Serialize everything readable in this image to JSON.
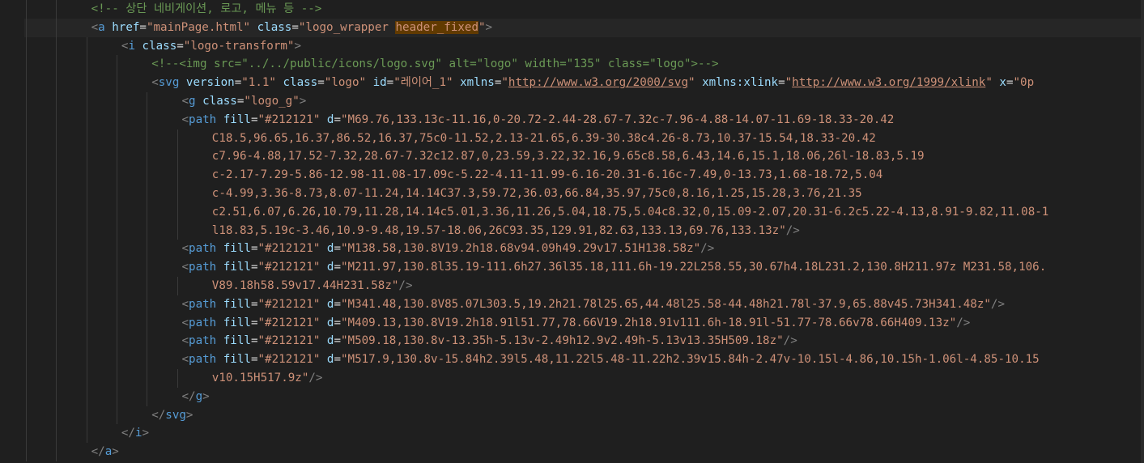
{
  "colors": {
    "background": "#1f1f1f",
    "comment": "#6a9955",
    "tag": "#569cd6",
    "attribute": "#9cdcfe",
    "string": "#ce9178",
    "punctuation": "#808080",
    "highlight": "#613a00"
  },
  "lines": [
    {
      "indent": 2,
      "tokens": [
        {
          "t": "com",
          "v": "<!-- 상단 네비게이션, 로고, 메뉴 등 -->"
        }
      ]
    },
    {
      "indent": 2,
      "active": true,
      "tokens": [
        {
          "t": "punc",
          "v": "<"
        },
        {
          "t": "tag",
          "v": "a"
        },
        {
          "t": "eq",
          "v": " "
        },
        {
          "t": "attr",
          "v": "href"
        },
        {
          "t": "eq",
          "v": "="
        },
        {
          "t": "str",
          "v": "\"mainPage.html\""
        },
        {
          "t": "eq",
          "v": " "
        },
        {
          "t": "attr",
          "v": "class"
        },
        {
          "t": "eq",
          "v": "="
        },
        {
          "t": "str",
          "v": "\"logo_wrapper "
        },
        {
          "t": "hl",
          "v": "header_fixed"
        },
        {
          "t": "str",
          "v": "\""
        },
        {
          "t": "punc",
          "v": ">"
        }
      ]
    },
    {
      "indent": 3,
      "tokens": [
        {
          "t": "punc",
          "v": "<"
        },
        {
          "t": "tag",
          "v": "i"
        },
        {
          "t": "eq",
          "v": " "
        },
        {
          "t": "attr",
          "v": "class"
        },
        {
          "t": "eq",
          "v": "="
        },
        {
          "t": "str",
          "v": "\"logo-transform\""
        },
        {
          "t": "punc",
          "v": ">"
        }
      ]
    },
    {
      "indent": 4,
      "tokens": [
        {
          "t": "com",
          "v": "<!--<img src=\"../../public/icons/logo.svg\" alt=\"logo\" width=\"135\" class=\"logo\">-->"
        }
      ]
    },
    {
      "indent": 4,
      "tokens": [
        {
          "t": "punc",
          "v": "<"
        },
        {
          "t": "tag",
          "v": "svg"
        },
        {
          "t": "eq",
          "v": " "
        },
        {
          "t": "attr",
          "v": "version"
        },
        {
          "t": "eq",
          "v": "="
        },
        {
          "t": "str",
          "v": "\"1.1\""
        },
        {
          "t": "eq",
          "v": " "
        },
        {
          "t": "attr",
          "v": "class"
        },
        {
          "t": "eq",
          "v": "="
        },
        {
          "t": "str",
          "v": "\"logo\""
        },
        {
          "t": "eq",
          "v": " "
        },
        {
          "t": "attr",
          "v": "id"
        },
        {
          "t": "eq",
          "v": "="
        },
        {
          "t": "str",
          "v": "\"레이어_1\""
        },
        {
          "t": "eq",
          "v": " "
        },
        {
          "t": "attr",
          "v": "xmlns"
        },
        {
          "t": "eq",
          "v": "="
        },
        {
          "t": "str",
          "v": "\""
        },
        {
          "t": "url",
          "v": "http://www.w3.org/2000/svg"
        },
        {
          "t": "str",
          "v": "\""
        },
        {
          "t": "eq",
          "v": " "
        },
        {
          "t": "attr",
          "v": "xmlns:xlink"
        },
        {
          "t": "eq",
          "v": "="
        },
        {
          "t": "str",
          "v": "\""
        },
        {
          "t": "url",
          "v": "http://www.w3.org/1999/xlink"
        },
        {
          "t": "str",
          "v": "\""
        },
        {
          "t": "eq",
          "v": " "
        },
        {
          "t": "attr",
          "v": "x"
        },
        {
          "t": "eq",
          "v": "="
        },
        {
          "t": "str",
          "v": "\"0p"
        }
      ]
    },
    {
      "indent": 5,
      "tokens": [
        {
          "t": "punc",
          "v": "<"
        },
        {
          "t": "tag",
          "v": "g"
        },
        {
          "t": "eq",
          "v": " "
        },
        {
          "t": "attr",
          "v": "class"
        },
        {
          "t": "eq",
          "v": "="
        },
        {
          "t": "str",
          "v": "\"logo_g\""
        },
        {
          "t": "punc",
          "v": ">"
        }
      ]
    },
    {
      "indent": 5,
      "tokens": [
        {
          "t": "punc",
          "v": "<"
        },
        {
          "t": "tag",
          "v": "path"
        },
        {
          "t": "eq",
          "v": " "
        },
        {
          "t": "attr",
          "v": "fill"
        },
        {
          "t": "eq",
          "v": "="
        },
        {
          "t": "str",
          "v": "\"#212121\""
        },
        {
          "t": "eq",
          "v": " "
        },
        {
          "t": "attr",
          "v": "d"
        },
        {
          "t": "eq",
          "v": "="
        },
        {
          "t": "str",
          "v": "\"M69.76,133.13c-11.16,0-20.72-2.44-28.67-7.32c-7.96-4.88-14.07-11.69-18.33-20.42"
        }
      ]
    },
    {
      "indent": 6,
      "tokens": [
        {
          "t": "str",
          "v": "C18.5,96.65,16.37,86.52,16.37,75c0-11.52,2.13-21.65,6.39-30.38c4.26-8.73,10.37-15.54,18.33-20.42"
        }
      ]
    },
    {
      "indent": 6,
      "tokens": [
        {
          "t": "str",
          "v": "c7.96-4.88,17.52-7.32,28.67-7.32c12.87,0,23.59,3.22,32.16,9.65c8.58,6.43,14.6,15.1,18.06,26l-18.83,5.19"
        }
      ]
    },
    {
      "indent": 6,
      "tokens": [
        {
          "t": "str",
          "v": "c-2.17-7.29-5.86-12.98-11.08-17.09c-5.22-4.11-11.99-6.16-20.31-6.16c-7.49,0-13.73,1.68-18.72,5.04"
        }
      ]
    },
    {
      "indent": 6,
      "tokens": [
        {
          "t": "str",
          "v": "c-4.99,3.36-8.73,8.07-11.24,14.14C37.3,59.72,36.03,66.84,35.97,75c0,8.16,1.25,15.28,3.76,21.35"
        }
      ]
    },
    {
      "indent": 6,
      "tokens": [
        {
          "t": "str",
          "v": "c2.51,6.07,6.26,10.79,11.28,14.14c5.01,3.36,11.26,5.04,18.75,5.04c8.32,0,15.09-2.07,20.31-6.2c5.22-4.13,8.91-9.82,11.08-1"
        }
      ]
    },
    {
      "indent": 6,
      "tokens": [
        {
          "t": "str",
          "v": "l18.83,5.19c-3.46,10.9-9.48,19.57-18.06,26C93.35,129.91,82.63,133.13,69.76,133.13z\""
        },
        {
          "t": "punc",
          "v": "/>"
        }
      ]
    },
    {
      "indent": 5,
      "tokens": [
        {
          "t": "punc",
          "v": "<"
        },
        {
          "t": "tag",
          "v": "path"
        },
        {
          "t": "eq",
          "v": " "
        },
        {
          "t": "attr",
          "v": "fill"
        },
        {
          "t": "eq",
          "v": "="
        },
        {
          "t": "str",
          "v": "\"#212121\""
        },
        {
          "t": "eq",
          "v": " "
        },
        {
          "t": "attr",
          "v": "d"
        },
        {
          "t": "eq",
          "v": "="
        },
        {
          "t": "str",
          "v": "\"M138.58,130.8V19.2h18.68v94.09h49.29v17.51H138.58z\""
        },
        {
          "t": "punc",
          "v": "/>"
        }
      ]
    },
    {
      "indent": 5,
      "tokens": [
        {
          "t": "punc",
          "v": "<"
        },
        {
          "t": "tag",
          "v": "path"
        },
        {
          "t": "eq",
          "v": " "
        },
        {
          "t": "attr",
          "v": "fill"
        },
        {
          "t": "eq",
          "v": "="
        },
        {
          "t": "str",
          "v": "\"#212121\""
        },
        {
          "t": "eq",
          "v": " "
        },
        {
          "t": "attr",
          "v": "d"
        },
        {
          "t": "eq",
          "v": "="
        },
        {
          "t": "str",
          "v": "\"M211.97,130.8l35.19-111.6h27.36l35.18,111.6h-19.22L258.55,30.67h4.18L231.2,130.8H211.97z M231.58,106."
        }
      ]
    },
    {
      "indent": 6,
      "tokens": [
        {
          "t": "str",
          "v": "V89.18h58.59v17.44H231.58z\""
        },
        {
          "t": "punc",
          "v": "/>"
        }
      ]
    },
    {
      "indent": 5,
      "tokens": [
        {
          "t": "punc",
          "v": "<"
        },
        {
          "t": "tag",
          "v": "path"
        },
        {
          "t": "eq",
          "v": " "
        },
        {
          "t": "attr",
          "v": "fill"
        },
        {
          "t": "eq",
          "v": "="
        },
        {
          "t": "str",
          "v": "\"#212121\""
        },
        {
          "t": "eq",
          "v": " "
        },
        {
          "t": "attr",
          "v": "d"
        },
        {
          "t": "eq",
          "v": "="
        },
        {
          "t": "str",
          "v": "\"M341.48,130.8V85.07L303.5,19.2h21.78l25.65,44.48l25.58-44.48h21.78l-37.9,65.88v45.73H341.48z\""
        },
        {
          "t": "punc",
          "v": "/>"
        }
      ]
    },
    {
      "indent": 5,
      "tokens": [
        {
          "t": "punc",
          "v": "<"
        },
        {
          "t": "tag",
          "v": "path"
        },
        {
          "t": "eq",
          "v": " "
        },
        {
          "t": "attr",
          "v": "fill"
        },
        {
          "t": "eq",
          "v": "="
        },
        {
          "t": "str",
          "v": "\"#212121\""
        },
        {
          "t": "eq",
          "v": " "
        },
        {
          "t": "attr",
          "v": "d"
        },
        {
          "t": "eq",
          "v": "="
        },
        {
          "t": "str",
          "v": "\"M409.13,130.8V19.2h18.91l51.77,78.66V19.2h18.91v111.6h-18.91l-51.77-78.66v78.66H409.13z\""
        },
        {
          "t": "punc",
          "v": "/>"
        }
      ]
    },
    {
      "indent": 5,
      "tokens": [
        {
          "t": "punc",
          "v": "<"
        },
        {
          "t": "tag",
          "v": "path"
        },
        {
          "t": "eq",
          "v": " "
        },
        {
          "t": "attr",
          "v": "fill"
        },
        {
          "t": "eq",
          "v": "="
        },
        {
          "t": "str",
          "v": "\"#212121\""
        },
        {
          "t": "eq",
          "v": " "
        },
        {
          "t": "attr",
          "v": "d"
        },
        {
          "t": "eq",
          "v": "="
        },
        {
          "t": "str",
          "v": "\"M509.18,130.8v-13.35h-5.13v-2.49h12.9v2.49h-5.13v13.35H509.18z\""
        },
        {
          "t": "punc",
          "v": "/>"
        }
      ]
    },
    {
      "indent": 5,
      "tokens": [
        {
          "t": "punc",
          "v": "<"
        },
        {
          "t": "tag",
          "v": "path"
        },
        {
          "t": "eq",
          "v": " "
        },
        {
          "t": "attr",
          "v": "fill"
        },
        {
          "t": "eq",
          "v": "="
        },
        {
          "t": "str",
          "v": "\"#212121\""
        },
        {
          "t": "eq",
          "v": " "
        },
        {
          "t": "attr",
          "v": "d"
        },
        {
          "t": "eq",
          "v": "="
        },
        {
          "t": "str",
          "v": "\"M517.9,130.8v-15.84h2.39l5.48,11.22l5.48-11.22h2.39v15.84h-2.47v-10.15l-4.86,10.15h-1.06l-4.85-10.15"
        }
      ]
    },
    {
      "indent": 6,
      "tokens": [
        {
          "t": "str",
          "v": "v10.15H517.9z\""
        },
        {
          "t": "punc",
          "v": "/>"
        }
      ]
    },
    {
      "indent": 5,
      "tokens": [
        {
          "t": "punc",
          "v": "</"
        },
        {
          "t": "tag",
          "v": "g"
        },
        {
          "t": "punc",
          "v": ">"
        }
      ]
    },
    {
      "indent": 4,
      "tokens": [
        {
          "t": "punc",
          "v": "</"
        },
        {
          "t": "tag",
          "v": "svg"
        },
        {
          "t": "punc",
          "v": ">"
        }
      ]
    },
    {
      "indent": 3,
      "tokens": [
        {
          "t": "punc",
          "v": "</"
        },
        {
          "t": "tag",
          "v": "i"
        },
        {
          "t": "punc",
          "v": ">"
        }
      ]
    },
    {
      "indent": 2,
      "tokens": [
        {
          "t": "punc",
          "v": "</"
        },
        {
          "t": "tag",
          "v": "a"
        },
        {
          "t": "punc",
          "v": ">"
        }
      ]
    }
  ]
}
